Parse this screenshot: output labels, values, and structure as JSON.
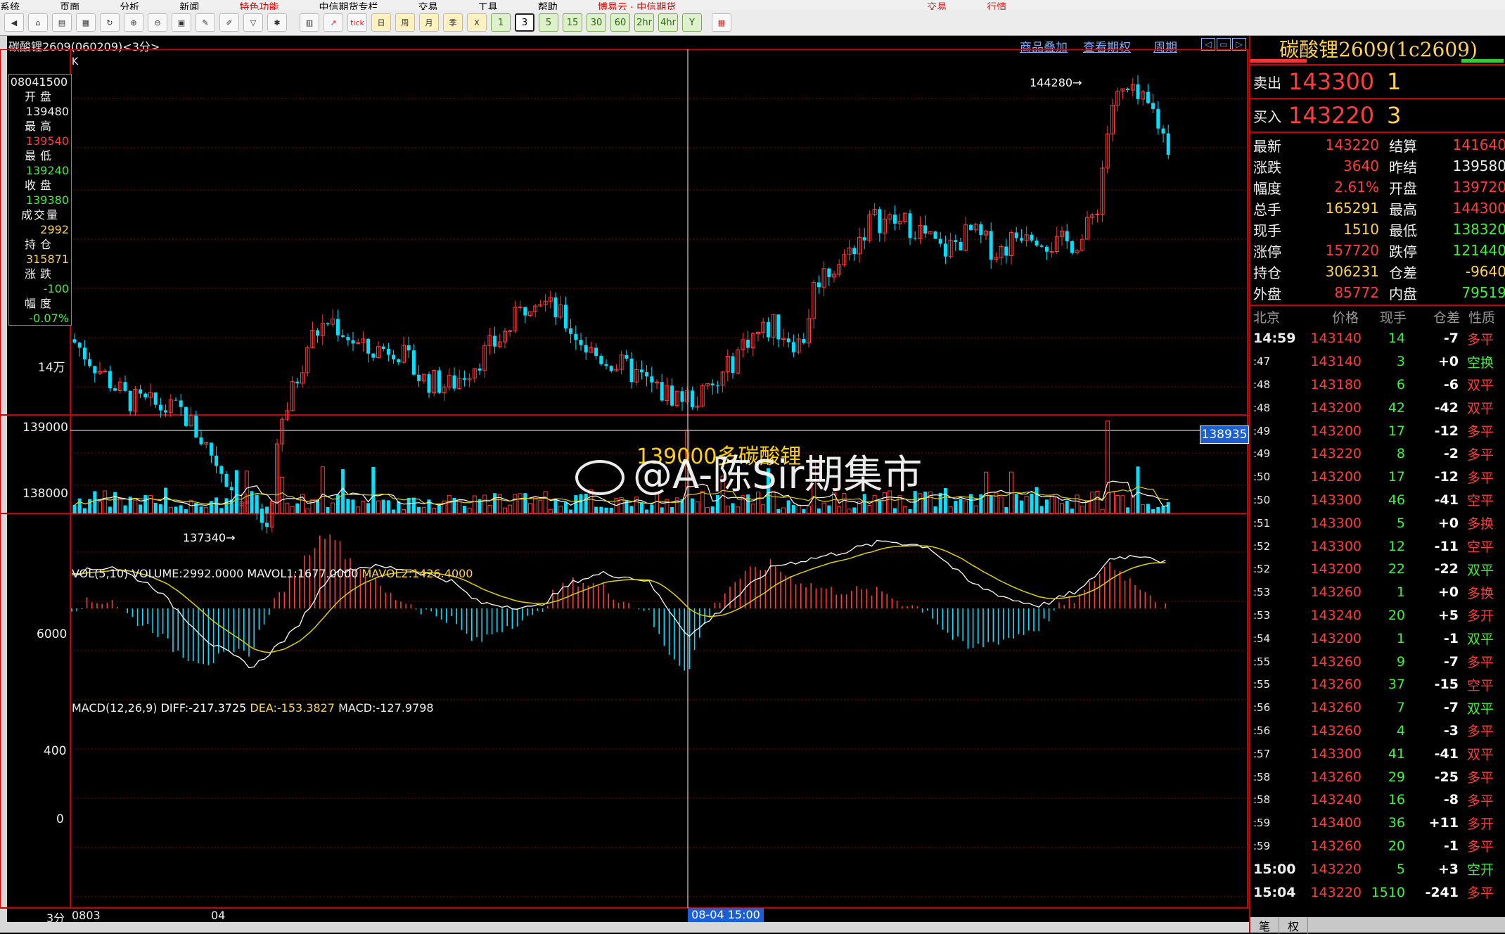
{
  "menu": [
    "系统",
    "页面",
    "分析",
    "新闻",
    "特色功能",
    "中信期货专栏",
    "交易",
    "工具",
    "帮助",
    "博易云 · 中信期货",
    "交易",
    "行情"
  ],
  "toolbar": {
    "periods": [
      "1",
      "3",
      "5",
      "15",
      "30",
      "60",
      "2hr",
      "4hr",
      "Y"
    ],
    "selected_period": "3",
    "tools": [
      "tick",
      "日",
      "周",
      "月",
      "季",
      "X"
    ]
  },
  "chart": {
    "title": "碳酸锂2609(060209)<3分>",
    "k_label": "K",
    "links": [
      "商品叠加",
      "查看期权",
      "周期"
    ],
    "y_labels": [
      "14万",
      "139000",
      "138000"
    ],
    "crosshair_price": "138935",
    "annot_high": "144280→",
    "annot_low": "137340→",
    "annotation_text": "139000多碳酸锂",
    "watermark": "@A-陈Sir期集市",
    "x_labels": [
      "3分",
      "0803",
      "04"
    ],
    "x_selected": "08-04 15:00"
  },
  "cursor_info": {
    "time": "08041500",
    "rows": [
      {
        "label": "开盘",
        "value": "139480",
        "color": "#eee"
      },
      {
        "label": "最高",
        "value": "139540",
        "color": "#ff3b3b"
      },
      {
        "label": "最低",
        "value": "139240",
        "color": "#3cf23c"
      },
      {
        "label": "收盘",
        "value": "139380",
        "color": "#3cf23c"
      },
      {
        "label": "成交量",
        "value": "2992",
        "color": "#ffd24a"
      },
      {
        "label": "持仓",
        "value": "315871",
        "color": "#ffd24a"
      },
      {
        "label": "涨跌",
        "value": "-100",
        "color": "#3cf23c"
      },
      {
        "label": "幅度",
        "value": "-0.07%",
        "color": "#3cf23c"
      }
    ]
  },
  "volume": {
    "label": "VOL(5,10)",
    "volume": "VOLUME:2992.0000",
    "mavol1": "MAVOL1:1677.0000",
    "mavol2": "MAVOL2:1426.4000",
    "y_label": "6000"
  },
  "macd": {
    "label": "MACD(12,26,9)",
    "diff": "DIFF:-217.3725",
    "dea": "DEA:-153.3827",
    "macd": "MACD:-127.9798",
    "y_labels": [
      "400",
      "0"
    ]
  },
  "quote": {
    "title": "碳酸锂2609(1c2609)",
    "ask": {
      "label": "卖出",
      "price": "143300",
      "qty": "1"
    },
    "bid": {
      "label": "买入",
      "price": "143220",
      "qty": "3"
    },
    "stats": [
      {
        "k": "最新",
        "v": "143220",
        "c": "#ff3b3b",
        "k2": "结算",
        "v2": "141640",
        "c2": "#ff3b3b"
      },
      {
        "k": "涨跌",
        "v": "3640",
        "c": "#ff3b3b",
        "k2": "昨结",
        "v2": "139580",
        "c2": "#eee"
      },
      {
        "k": "幅度",
        "v": "2.61%",
        "c": "#ff3b3b",
        "k2": "开盘",
        "v2": "139720",
        "c2": "#ff3b3b"
      },
      {
        "k": "总手",
        "v": "165291",
        "c": "#ffd24a",
        "k2": "最高",
        "v2": "144300",
        "c2": "#ff3b3b"
      },
      {
        "k": "现手",
        "v": "1510",
        "c": "#ffd24a",
        "k2": "最低",
        "v2": "138320",
        "c2": "#3cf23c"
      },
      {
        "k": "涨停",
        "v": "157720",
        "c": "#ff3b3b",
        "k2": "跌停",
        "v2": "121440",
        "c2": "#3cf23c"
      },
      {
        "k": "持仓",
        "v": "306231",
        "c": "#ffd24a",
        "k2": "仓差",
        "v2": "-9640",
        "c2": "#ffd24a"
      },
      {
        "k": "外盘",
        "v": "85772",
        "c": "#ff3b3b",
        "k2": "内盘",
        "v2": "79519",
        "c2": "#3cf23c"
      }
    ],
    "table_head": [
      "北京",
      "价格",
      "现手",
      "仓差",
      "性质"
    ],
    "ticks": [
      {
        "t": "14:59",
        "p": "143140",
        "q": "14",
        "d": "-7",
        "n": "多平",
        "nc": "#ff3b3b"
      },
      {
        "t": ":47",
        "p": "143140",
        "q": "3",
        "d": "+0",
        "n": "空换",
        "nc": "#3cf23c"
      },
      {
        "t": ":48",
        "p": "143180",
        "q": "6",
        "d": "-6",
        "n": "双平",
        "nc": "#ff3b3b"
      },
      {
        "t": ":48",
        "p": "143200",
        "q": "42",
        "d": "-42",
        "n": "双平",
        "nc": "#ff3b3b"
      },
      {
        "t": ":49",
        "p": "143200",
        "q": "17",
        "d": "-12",
        "n": "多平",
        "nc": "#ff3b3b"
      },
      {
        "t": ":49",
        "p": "143220",
        "q": "8",
        "d": "-2",
        "n": "多平",
        "nc": "#ff3b3b"
      },
      {
        "t": ":50",
        "p": "143200",
        "q": "17",
        "d": "-12",
        "n": "多平",
        "nc": "#ff3b3b"
      },
      {
        "t": ":50",
        "p": "143300",
        "q": "46",
        "d": "-41",
        "n": "空平",
        "nc": "#ff3b3b"
      },
      {
        "t": ":51",
        "p": "143300",
        "q": "5",
        "d": "+0",
        "n": "多换",
        "nc": "#ff3b3b"
      },
      {
        "t": ":52",
        "p": "143300",
        "q": "12",
        "d": "-11",
        "n": "空平",
        "nc": "#ff3b3b"
      },
      {
        "t": ":52",
        "p": "143200",
        "q": "22",
        "d": "-22",
        "n": "双平",
        "nc": "#3cf23c"
      },
      {
        "t": ":53",
        "p": "143260",
        "q": "1",
        "d": "+0",
        "n": "多换",
        "nc": "#ff3b3b"
      },
      {
        "t": ":53",
        "p": "143240",
        "q": "20",
        "d": "+5",
        "n": "多开",
        "nc": "#ff3b3b"
      },
      {
        "t": ":54",
        "p": "143200",
        "q": "1",
        "d": "-1",
        "n": "双平",
        "nc": "#3cf23c"
      },
      {
        "t": ":55",
        "p": "143260",
        "q": "9",
        "d": "-7",
        "n": "多平",
        "nc": "#ff3b3b"
      },
      {
        "t": ":55",
        "p": "143260",
        "q": "37",
        "d": "-15",
        "n": "空平",
        "nc": "#ff3b3b"
      },
      {
        "t": ":56",
        "p": "143260",
        "q": "7",
        "d": "-7",
        "n": "双平",
        "nc": "#3cf23c"
      },
      {
        "t": ":56",
        "p": "143260",
        "q": "4",
        "d": "-3",
        "n": "多平",
        "nc": "#ff3b3b"
      },
      {
        "t": ":57",
        "p": "143300",
        "q": "41",
        "d": "-41",
        "n": "双平",
        "nc": "#ff3b3b"
      },
      {
        "t": ":58",
        "p": "143260",
        "q": "29",
        "d": "-25",
        "n": "多平",
        "nc": "#ff3b3b"
      },
      {
        "t": ":58",
        "p": "143240",
        "q": "16",
        "d": "-8",
        "n": "多平",
        "nc": "#ff3b3b"
      },
      {
        "t": ":59",
        "p": "143400",
        "q": "36",
        "d": "+11",
        "n": "多开",
        "nc": "#ff3b3b"
      },
      {
        "t": ":59",
        "p": "143260",
        "q": "20",
        "d": "-1",
        "n": "多平",
        "nc": "#ff3b3b"
      },
      {
        "t": "15:00",
        "p": "143220",
        "q": "5",
        "d": "+3",
        "n": "空开",
        "nc": "#3cf23c"
      },
      {
        "t": "15:04",
        "p": "143220",
        "q": "1510",
        "d": "-241",
        "n": "多平",
        "nc": "#ff3b3b"
      }
    ],
    "tabs": [
      "笔",
      "权"
    ]
  },
  "colors": {
    "up": "#ff3b3b",
    "down": "#00e0ff",
    "accent": "#ffd24a",
    "grid": "#8b0000"
  }
}
